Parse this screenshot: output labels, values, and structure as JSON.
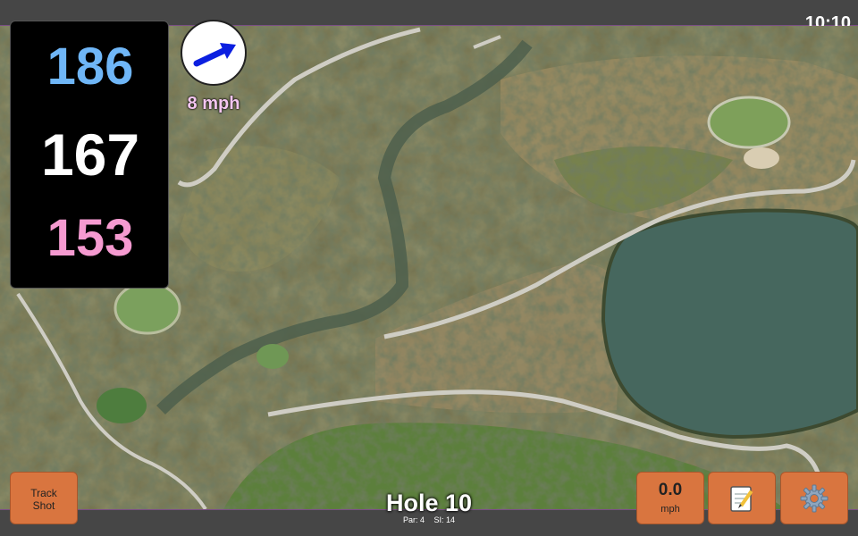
{
  "status": {
    "time": "10:10"
  },
  "yardage": {
    "back": "186",
    "middle": "167",
    "front": "153"
  },
  "wind": {
    "speed": "8 mph",
    "icon": "arrow-icon",
    "color": "#0b1fe0"
  },
  "hole": {
    "title": "Hole 10",
    "par": "Par: 4",
    "si": "SI: 14"
  },
  "buttons": {
    "track_shot": "Track\nShot",
    "speed_value": "0.0",
    "speed_unit": "mph",
    "notes_icon": "notepad-icon",
    "settings_icon": "gear-icon"
  },
  "colors": {
    "button": "#d9753f",
    "back": "#6fb6f7",
    "middle": "#ffffff",
    "front": "#f59ad0",
    "wind_text": "#f4c6f0"
  }
}
